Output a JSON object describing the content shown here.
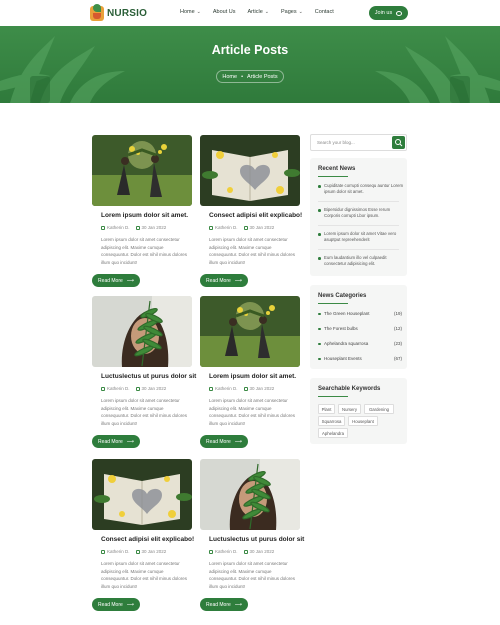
{
  "header": {
    "logo_text": "NURSIO",
    "nav": [
      {
        "label": "Home",
        "chevron": true
      },
      {
        "label": "About Us",
        "chevron": false
      },
      {
        "label": "Article",
        "chevron": true
      },
      {
        "label": "Pages",
        "chevron": true
      },
      {
        "label": "Contact",
        "chevron": false
      }
    ],
    "join_label": "Join us"
  },
  "banner": {
    "title": "Article Posts",
    "breadcrumb": {
      "home": "Home",
      "current": "Article Posts"
    }
  },
  "posts": [
    {
      "title": "Lorem ipsum dolor sit amet.",
      "author": "Katherin D.",
      "date": "30 Jan 2022",
      "excerpt": "Lorem ipsum dolor sit amet consectetur adipiscing elit. Maxime cumque consequuntur. Dolor est nihil minus dolores illum quo incidunt!",
      "button": "Read More",
      "image": "dancers"
    },
    {
      "title": "Consect adipisi elit explicabo!",
      "author": "Katherin D.",
      "date": "30 Jan 2022",
      "excerpt": "Lorem ipsum dolor sit amet consectetur adipiscing elit. Maxime cumque consequuntur. Dolor est nihil minus dolores illum quo incidunt!",
      "button": "Read More",
      "image": "book"
    },
    {
      "title": "Luctuslectus ut purus dolor sit",
      "author": "Katherin D.",
      "date": "30 Jan 2022",
      "excerpt": "Lorem ipsum dolor sit amet consectetur adipiscing elit. Maxime cumque consequuntur. Dolor est nihil minus dolores illum quo incidunt!",
      "button": "Read More",
      "image": "fern"
    },
    {
      "title": "Lorem ipsum dolor sit amet.",
      "author": "Katherin D.",
      "date": "30 Jan 2022",
      "excerpt": "Lorem ipsum dolor sit amet consectetur adipiscing elit. Maxime cumque consequuntur. Dolor est nihil minus dolores illum quo incidunt!",
      "button": "Read More",
      "image": "dancers"
    },
    {
      "title": "Consect adipisi elit explicabo!",
      "author": "Katherin D.",
      "date": "30 Jan 2022",
      "excerpt": "Lorem ipsum dolor sit amet consectetur adipiscing elit. Maxime cumque consequuntur. Dolor est nihil minus dolores illum quo incidunt!",
      "button": "Read More",
      "image": "book"
    },
    {
      "title": "Luctuslectus ut purus dolor sit",
      "author": "Katherin D.",
      "date": "30 Jan 2022",
      "excerpt": "Lorem ipsum dolor sit amet consectetur adipiscing elit. Maxime cumque consequuntur. Dolor est nihil minus dolores illum quo incidunt!",
      "button": "Read More",
      "image": "fern"
    }
  ],
  "sidebar": {
    "search_placeholder": "Search your blog...",
    "recent_news_title": "Recent News",
    "recent_news": [
      "Cupiditate corrupti consequ auntur Lorem ipsum dolor sit amet.",
      "Bipersidur dignissimos Esse rerum Corporis corrupti Lbor ipsum.",
      "Lorem ipsum dolor sit amet Vitae vero asuptput repreehenderit",
      "Eum laudantium illo vel culpaedit consectetur adipisicing elit."
    ],
    "categories_title": "News Categories",
    "categories": [
      {
        "name": "The Green Houseplant",
        "count": "(19)"
      },
      {
        "name": "The Forest bulbs",
        "count": "(12)"
      },
      {
        "name": "Aphelandra squarrosa",
        "count": "(23)"
      },
      {
        "name": "Houseplant Events",
        "count": "(67)"
      }
    ],
    "keywords_title": "Searchable Keywords",
    "keywords": [
      "Plant",
      "Nursery",
      "Gardening",
      "Squarrosa",
      "Houseplant",
      "Aphelandra"
    ]
  },
  "colors": {
    "accent": "#2e7d3c",
    "banner": "#3a8a46"
  }
}
